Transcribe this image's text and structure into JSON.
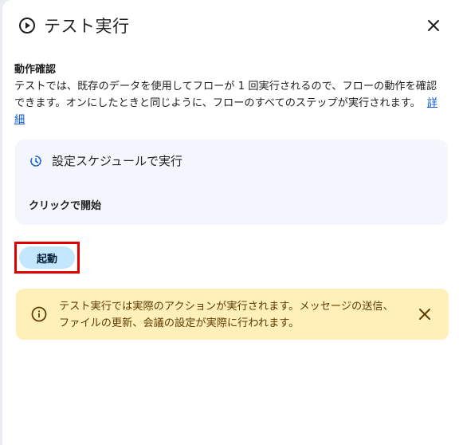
{
  "dialog": {
    "title": "テスト実行",
    "close_label": "閉じる"
  },
  "section": {
    "title": "動作確認",
    "description": "テストでは、既存のデータを使用してフローが 1 回実行されるので、フローの動作を確認できます。オンにしたときと同じように、フローのすべてのステップが実行されます。",
    "details_link": "詳細"
  },
  "card": {
    "schedule_label": "設定スケジュールで実行",
    "start_label": "クリックで開始"
  },
  "launch_button": {
    "label": "起動"
  },
  "warning": {
    "message": "テスト実行では実際のアクションが実行されます。メッセージの送信、ファイルの更新、会議の設定が実際に行われます。"
  },
  "icons": {
    "header": "play-circle-icon",
    "close": "close-icon",
    "card": "clock-icon",
    "warning": "info-icon",
    "warning_dismiss": "close-icon"
  },
  "colors": {
    "button_bg": "#c2e7ff",
    "highlight_border": "#e00000",
    "warning_bg": "#ffefb8",
    "warning_text": "#5f3d00",
    "link": "#0b57d0"
  }
}
